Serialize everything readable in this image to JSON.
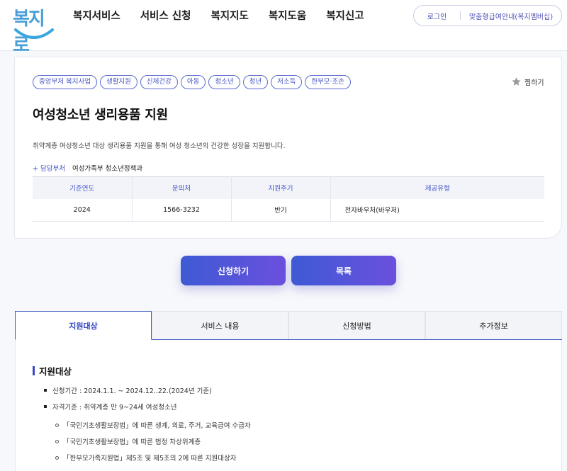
{
  "header": {
    "logo_text": "복지로",
    "nav": [
      "복지서비스",
      "서비스 신청",
      "복지지도",
      "복지도움",
      "복지신고"
    ],
    "login": "로그인",
    "custom_info": "맞춤형급여안내(복지멤버십)"
  },
  "service": {
    "tags": [
      "중앙부처 복지사업",
      "생활지원",
      "신체건강",
      "아동",
      "청소년",
      "청년",
      "저소득",
      "한부모·조손"
    ],
    "bookmark": "찜하기",
    "title": "여성청소년 생리용품 지원",
    "description": "취약계층 여성청소년 대상 생리용품 지원을 통해 여성 청소년의 건강한 성장을 지원합니다.",
    "dept_label": "+ 담당부처",
    "dept_value": "여성가족부 청소년정책과",
    "table": {
      "headers": [
        "기준연도",
        "문의처",
        "지원주기",
        "제공유형"
      ],
      "row": [
        "2024",
        "1566-3232",
        "반기",
        "전자바우처(바우처)"
      ]
    }
  },
  "buttons": {
    "apply": "신청하기",
    "list": "목록"
  },
  "tabs": [
    "지원대상",
    "서비스 내용",
    "신청방법",
    "추가정보"
  ],
  "content": {
    "section_title": "지원대상",
    "bullets": [
      "신청기간 : 2024.1.1. ~ 2024.12..22.(2024년 기준)",
      "자격기준 : 취약계층 만 9~24세 여성청소년"
    ],
    "sub_items": [
      "「국민기초생활보장법」에 따른 생계, 의료, 주거, 교육급여 수급자",
      "「국민기초생활보장법」에 따른 법정 차상위계층",
      "「한부모가족지원법」제5조 및 제5조의 2에 따른 지원대상자"
    ]
  },
  "colors": {
    "accent": "#3f56c8",
    "logo": "#4a9fd8"
  }
}
